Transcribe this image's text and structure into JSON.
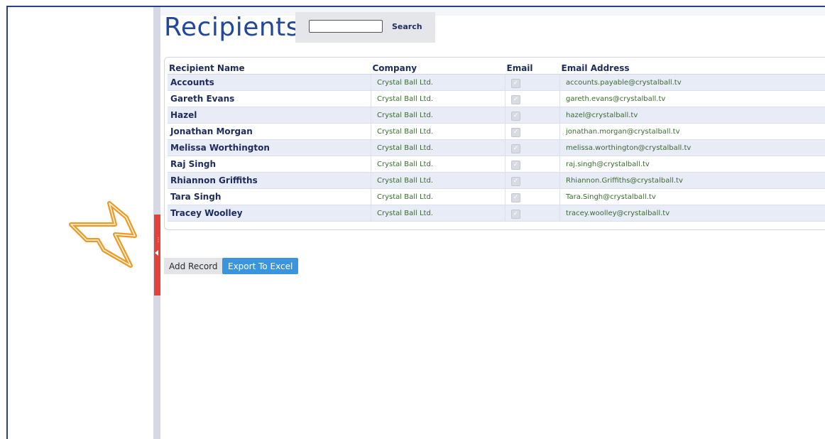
{
  "page": {
    "title": "Recipients"
  },
  "search": {
    "value": "",
    "placeholder": "",
    "button_label": "Search"
  },
  "table": {
    "columns": [
      "Recipient Name",
      "Company",
      "Email",
      "Email Address"
    ],
    "rows": [
      {
        "name": "Accounts",
        "company": "Crystal Ball Ltd.",
        "email": true,
        "address": "accounts.payable@crystalball.tv"
      },
      {
        "name": "Gareth Evans",
        "company": "Crystal Ball Ltd.",
        "email": true,
        "address": "gareth.evans@crystalball.tv"
      },
      {
        "name": "Hazel",
        "company": "Crystal Ball Ltd.",
        "email": true,
        "address": "hazel@crystalball.tv"
      },
      {
        "name": "Jonathan Morgan",
        "company": "Crystal Ball Ltd.",
        "email": true,
        "address": "jonathan.morgan@crystalball.tv"
      },
      {
        "name": "Melissa Worthington",
        "company": "Crystal Ball Ltd.",
        "email": true,
        "address": "melissa.worthington@crystalball.tv"
      },
      {
        "name": "Raj Singh",
        "company": "Crystal Ball Ltd.",
        "email": true,
        "address": "raj.singh@crystalball.tv"
      },
      {
        "name": "Rhiannon Griffiths",
        "company": "Crystal Ball Ltd.",
        "email": true,
        "address": "Rhiannon.Griffiths@crystalball.tv"
      },
      {
        "name": "Tara Singh",
        "company": "Crystal Ball Ltd.",
        "email": true,
        "address": "Tara.Singh@crystalball.tv"
      },
      {
        "name": "Tracey Woolley",
        "company": "Crystal Ball Ltd.",
        "email": true,
        "address": "tracey.woolley@crystalball.tv"
      }
    ]
  },
  "actions": {
    "add_label": "Add Record",
    "export_label": "Export To Excel"
  },
  "icons": {
    "annotation": "arrow-pointer-icon",
    "splitter": "collapse-arrow-icon"
  },
  "colors": {
    "accent": "#23479a",
    "splitter_handle": "#e3423a",
    "export_button": "#3b95de",
    "annotation_arrow": "#ee9a22"
  }
}
